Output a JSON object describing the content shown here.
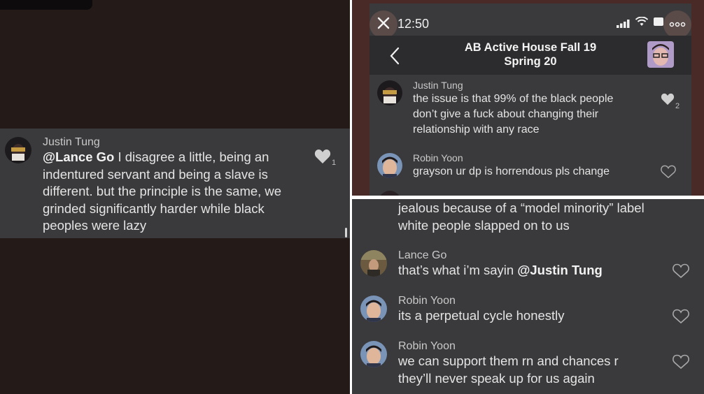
{
  "left_panel": {
    "sender": "Justin Tung",
    "mention": "@Lance Go",
    "message_lines": [
      " I disagree a little, being an",
      "indentured servant and being a slave is",
      "different. but the principle is the same, we",
      "grinded significantly harder while black",
      "peoples were lazy"
    ],
    "like_count": "1"
  },
  "top_right": {
    "status_time": "12:50",
    "close_icon": "close-icon",
    "more_icon": "more-options-icon",
    "back_icon": "back-chevron-icon",
    "title_line1": "AB Active House Fall 19",
    "title_line2": "Spring 20",
    "messages": [
      {
        "sender": "Justin Tung",
        "lines": [
          "the issue is that 99% of the black people",
          "don’t give a fuck about changing their",
          "relationship with any race"
        ],
        "like_count": "2"
      },
      {
        "sender": "Robin Yoon",
        "lines": [
          "grayson ur dp is horrendous pls change"
        ]
      }
    ]
  },
  "bottom_right": {
    "continued_lines": [
      "jealous because of a “model minority” label",
      "white people slapped on to us"
    ],
    "messages": [
      {
        "sender": "Lance Go",
        "text": "that’s what i’m sayin ",
        "mention": "@Justin Tung"
      },
      {
        "sender": "Robin Yoon",
        "lines": [
          "its a perpetual cycle honestly"
        ]
      },
      {
        "sender": "Robin Yoon",
        "lines": [
          "we can support them rn and chances r",
          "they’ll never speak up for us again"
        ]
      }
    ]
  },
  "colors": {
    "background_dark": "#241b19",
    "message_bubble": "#3a3a3c",
    "nav_bar": "#2c2c2e",
    "text": "#e4e4e4",
    "liked_heart": "#d0d0d0"
  }
}
